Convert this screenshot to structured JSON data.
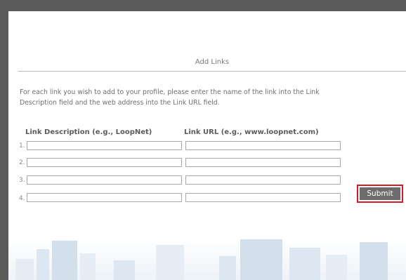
{
  "header": {
    "title": "Add Links"
  },
  "instructions": "For each link you wish to add to your profile, please enter the name of the link into the Link Description field and the web address into the Link URL field.",
  "columns": {
    "description": "Link Description (e.g., LoopNet)",
    "url": "Link URL (e.g., www.loopnet.com)"
  },
  "rows": [
    {
      "number": "1.",
      "description": "",
      "url": ""
    },
    {
      "number": "2.",
      "description": "",
      "url": ""
    },
    {
      "number": "3.",
      "description": "",
      "url": ""
    },
    {
      "number": "4.",
      "description": "",
      "url": ""
    }
  ],
  "actions": {
    "submit_label": "Submit"
  },
  "colors": {
    "highlight": "#d31b25",
    "button_bg": "#6c6c6c",
    "frame": "#5a5a5a"
  }
}
